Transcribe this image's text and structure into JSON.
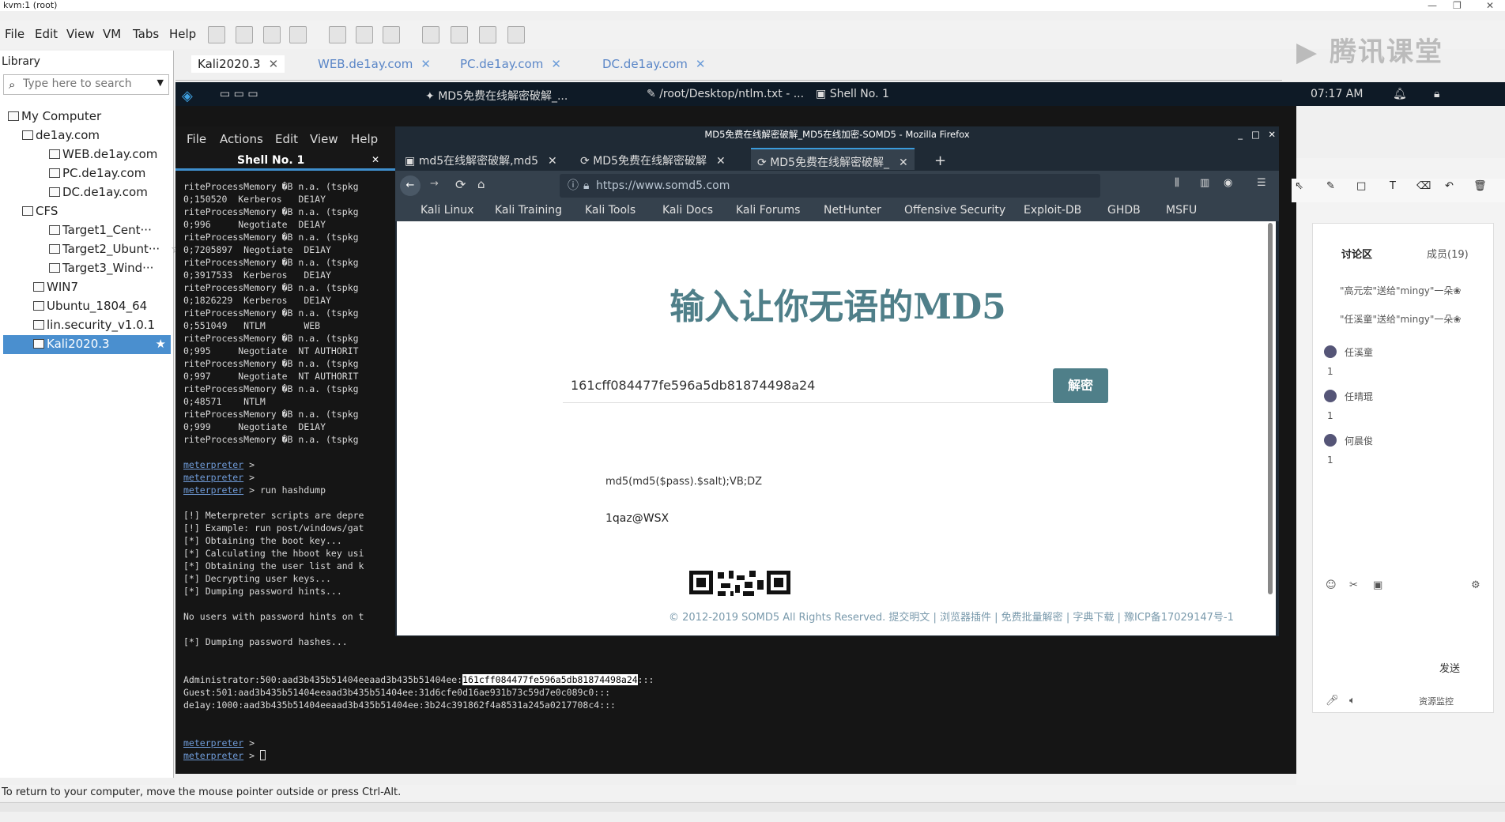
{
  "window_title": "kvm:1 (root)",
  "menu": [
    "File",
    "Edit",
    "View",
    "VM",
    "Tabs",
    "Help"
  ],
  "library": {
    "title": "Library",
    "search_placeholder": "Type here to search",
    "items": [
      "My Computer",
      "de1ay.com",
      "WEB.de1ay.com",
      "PC.de1ay.com",
      "DC.de1ay.com",
      "CFS",
      "Target1_Cent···",
      "Target2_Ubunt···",
      "Target3_Wind···",
      "WIN7",
      "Ubuntu_1804_64",
      "lin.security_v1.0.1",
      "Kali2020.3"
    ]
  },
  "vm_tabs": [
    "Kali2020.3",
    "WEB.de1ay.com",
    "PC.de1ay.com",
    "DC.de1ay.com"
  ],
  "watermark": "腾讯课堂",
  "kali_panel": {
    "tasks": [
      "MD5免费在线解密破解_...",
      "/root/Desktop/ntlm.txt - ...",
      "Shell No. 1"
    ],
    "time": "07:17 AM"
  },
  "terminal": {
    "menu": [
      "File",
      "Actions",
      "Edit",
      "View",
      "Help"
    ],
    "tab": "Shell No. 1",
    "lines": [
      "riteProcessMemory �B n.a. (tspkg",
      "0;150520  Kerberos   DE1AY",
      "riteProcessMemory �B n.a. (tspkg",
      "0;996     Negotiate  DE1AY",
      "riteProcessMemory �B n.a. (tspkg",
      "0;7205897  Negotiate  DE1AY",
      "riteProcessMemory �B n.a. (tspkg",
      "0;3917533  Kerberos   DE1AY",
      "riteProcessMemory �B n.a. (tspkg",
      "0;1826229  Kerberos   DE1AY",
      "riteProcessMemory �B n.a. (tspkg",
      "0;551049   NTLM       WEB",
      "riteProcessMemory �B n.a. (tspkg",
      "0;995     Negotiate  NT AUTHORIT",
      "riteProcessMemory �B n.a. (tspkg",
      "0;997     Negotiate  NT AUTHORIT",
      "riteProcessMemory �B n.a. (tspkg",
      "0;48571    NTLM",
      "riteProcessMemory �B n.a. (tspkg",
      "0;999     Negotiate  DE1AY",
      "riteProcessMemory �B n.a. (tspkg"
    ],
    "prompt": "meterpreter",
    "cmd": "run hashdump",
    "msgs": [
      "[!] Meterpreter scripts are depre",
      "[!] Example: run post/windows/gat",
      "[*] Obtaining the boot key...",
      "[*] Calculating the hboot key usi",
      "[*] Obtaining the user list and k",
      "[*] Decrypting user keys...",
      "[*] Dumping password hints...",
      "",
      "No users with password hints on t",
      "",
      "[*] Dumping password hashes..."
    ],
    "hash_admin_prefix": "Administrator:500:aad3b435b51404eeaad3b435b51404ee:",
    "hash_admin_nt": "161cff084477fe596a5db81874498a24",
    "hash_admin_suffix": ":::",
    "hash_guest": "Guest:501:aad3b435b51404eeaad3b435b51404ee:31d6cfe0d16ae931b73c59d7e0c089c0:::",
    "hash_delay": "de1ay:1000:aad3b435b51404eeaad3b435b51404ee:3b24c391862f4a8531a245a0217708c4:::"
  },
  "firefox": {
    "window_title": "MD5免费在线解密破解_MD5在线加密-SOMD5 - Mozilla Firefox",
    "tabs": [
      "md5在线解密破解,md5",
      "MD5免费在线解密破解",
      "MD5免费在线解密破解_"
    ],
    "url": "https://www.somd5.com",
    "bookmarks": [
      "Kali Linux",
      "Kali Training",
      "Kali Tools",
      "Kali Docs",
      "Kali Forums",
      "NetHunter",
      "Offensive Security",
      "Exploit-DB",
      "GHDB",
      "MSFU"
    ],
    "page_title": "输入让你无语的MD5",
    "hash_input": "161cff084477fe596a5db81874498a24",
    "decrypt_button": "解密",
    "hash_type": "md5(md5($pass).$salt);VB;DZ",
    "result": "1qaz@WSX",
    "footer": "© 2012-2019 SOMD5 All Rights Reserved. 提交明文 | 浏览器插件 | 免费批量解密 | 字典下载 | 豫ICP备17029147号-1"
  },
  "chat": {
    "tab_discuss": "讨论区",
    "tab_members": "成员(19)",
    "messages": [
      "\"高元宏\"送给\"mingy\"一朵❀",
      "\"任溪童\"送给\"mingy\"一朵❀"
    ],
    "users": [
      {
        "name": "任溪童",
        "count": "1"
      },
      {
        "name": "任晴琨",
        "count": "1"
      },
      {
        "name": "何晨俊",
        "count": "1"
      }
    ],
    "send": "发送",
    "resource": "资源监控"
  },
  "status_text": "To return to your computer, move the mouse pointer outside or press Ctrl-Alt."
}
